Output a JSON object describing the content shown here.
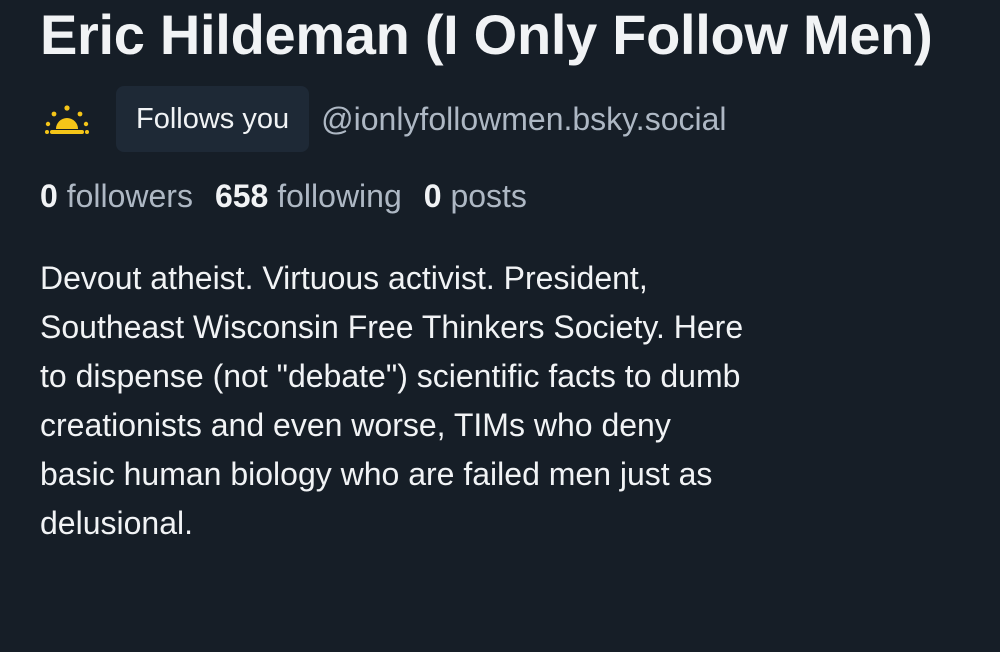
{
  "profile": {
    "display_name": "Eric Hildeman (I Only Follow Men)",
    "icon": "sunrise-icon",
    "follows_you_badge": "Follows you",
    "handle": "@ionlyfollowmen.bsky.social",
    "stats": {
      "followers_count": "0",
      "followers_label": "followers",
      "following_count": "658",
      "following_label": "following",
      "posts_count": "0",
      "posts_label": "posts"
    },
    "bio": "Devout atheist. Virtuous activist. President,\nSoutheast Wisconsin Free Thinkers Society. Here\nto dispense (not \"debate\") scientific facts to dumb\ncreationists and even worse, TIMs who deny\nbasic human biology who are failed men just as\ndelusional."
  },
  "colors": {
    "background": "#161e27",
    "text_primary": "#f1f3f5",
    "text_secondary": "#aeb8c4",
    "badge_background": "#1e2936",
    "icon_yellow": "#f5c518"
  }
}
